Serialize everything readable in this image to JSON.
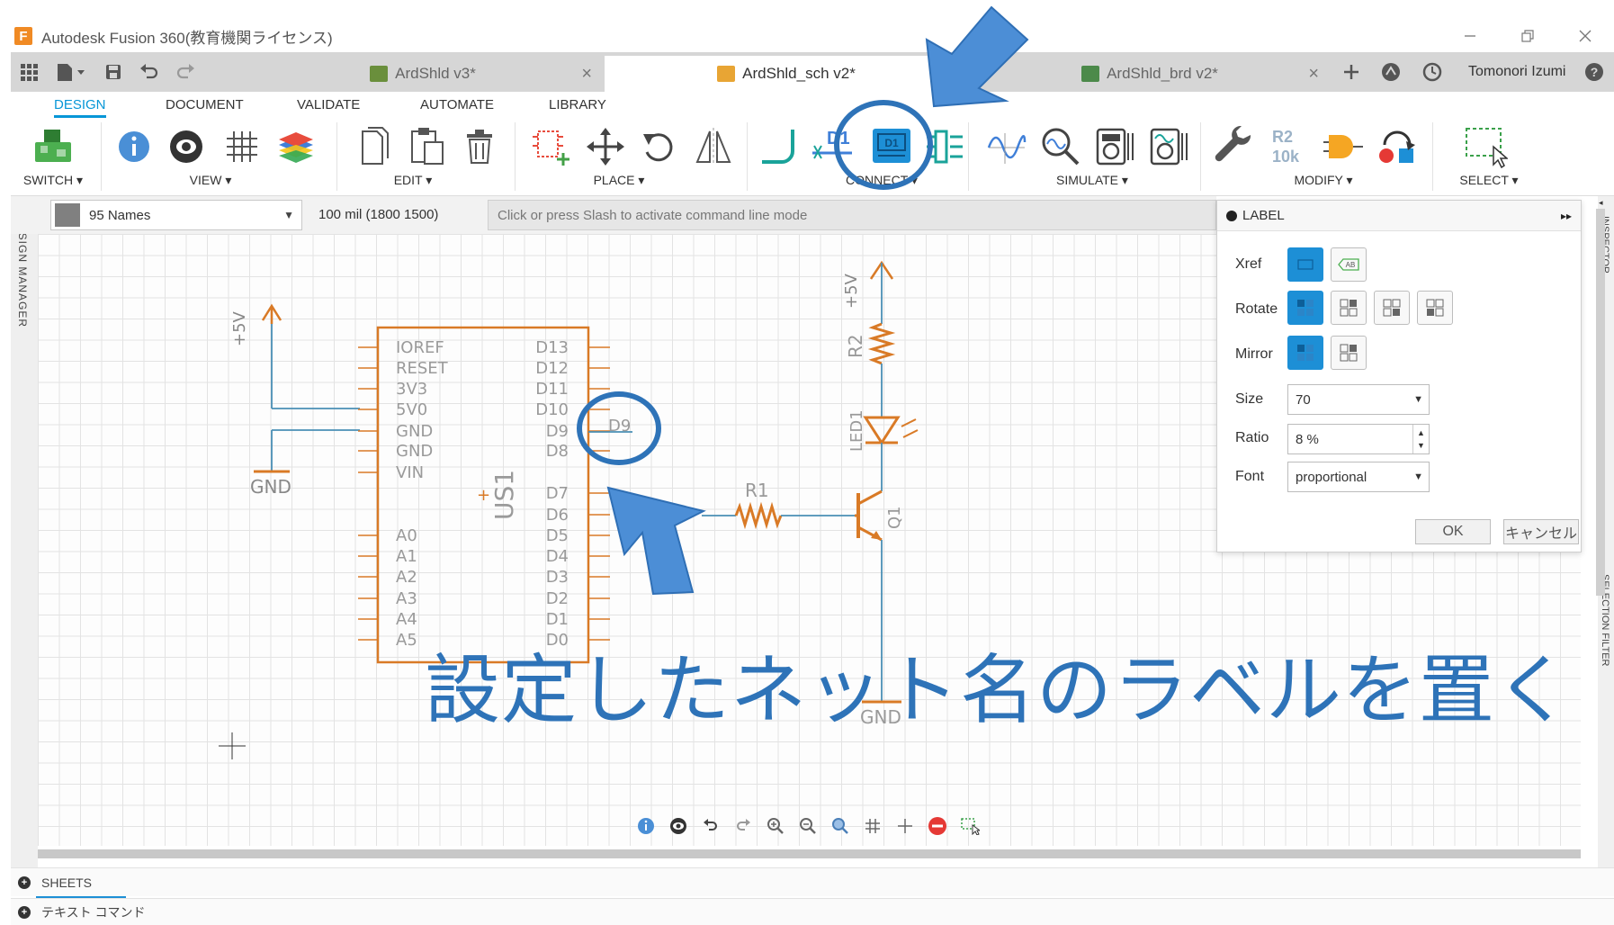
{
  "window": {
    "title": "Autodesk Fusion 360(教育機関ライセンス)",
    "logo_letter": "F"
  },
  "tabs": [
    {
      "label": "ArdShld v3*",
      "active": false
    },
    {
      "label": "ArdShld_sch v2*",
      "active": true
    },
    {
      "label": "ArdShld_brd v2*",
      "active": false
    }
  ],
  "user": {
    "name": "Tomonori Izumi"
  },
  "ribbon": {
    "tabs": [
      "DESIGN",
      "DOCUMENT",
      "VALIDATE",
      "AUTOMATE",
      "LIBRARY"
    ],
    "active_tab": "DESIGN",
    "groups": [
      "SWITCH ▾",
      "VIEW ▾",
      "EDIT ▾",
      "PLACE ▾",
      "CONNECT ▾",
      "SIMULATE ▾",
      "MODIFY ▾",
      "SELECT ▾"
    ],
    "tool_text": {
      "net_label": "D1",
      "value_top": "R2",
      "value_bottom": "10k"
    }
  },
  "command_row": {
    "layer": "95 Names",
    "grid": "100 mil (1800 1500)",
    "command_placeholder": "Click or press Slash to activate command line mode"
  },
  "side_panels": {
    "left": "DESIGN MANAGER",
    "right_top": "INSPECTOR",
    "right_bottom": "SELECTION FILTER"
  },
  "label_panel": {
    "title": "LABEL",
    "xref_label": "Xref",
    "xref_ab": "AB",
    "rotate_label": "Rotate",
    "mirror_label": "Mirror",
    "size_label": "Size",
    "size_value": "70",
    "ratio_label": "Ratio",
    "ratio_value": "8 %",
    "font_label": "Font",
    "font_value": "proportional",
    "ok": "OK",
    "cancel": "キャンセル"
  },
  "schematic": {
    "part_name": "US1",
    "left_pins": [
      "IOREF",
      "RESET",
      "3V3",
      "5V0",
      "GND",
      "GND",
      "VIN",
      "A0",
      "A1",
      "A2",
      "A3",
      "A4",
      "A5"
    ],
    "right_pins": [
      "D13",
      "D12",
      "D11",
      "D10",
      "D9",
      "D8",
      "D7",
      "D6",
      "D5",
      "D4",
      "D3",
      "D2",
      "D1",
      "D0"
    ],
    "net_label": "D9",
    "supply_5v": "+5V",
    "gnd": "GND",
    "r1": "R1",
    "r2": "R2",
    "led": "LED1",
    "transistor": "Q1"
  },
  "bottom": {
    "sheets": "SHEETS",
    "text_command": "テキスト コマンド"
  },
  "caption": "設定したネット名のラベルを置く",
  "colors": {
    "accent": "#0696d7",
    "schematic": "#d97a26",
    "net": "#4a8fb5",
    "annotation": "#2e73b8"
  }
}
